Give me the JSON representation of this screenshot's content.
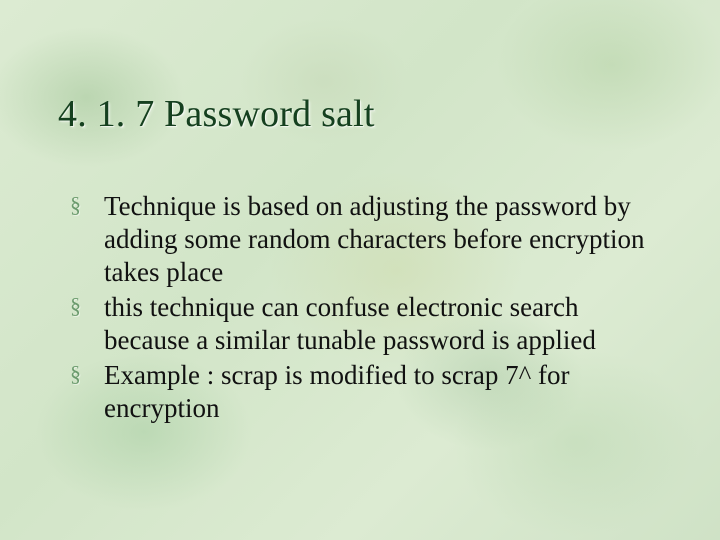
{
  "slide": {
    "title": "4. 1. 7 Password salt",
    "bullet_marker": "§",
    "bullets": [
      "Technique is based on adjusting the password by adding some random characters before encryption takes place",
      "this technique can confuse electronic  search because a similar tunable password is applied",
      "Example : scrap is modified to scrap 7^ for encryption"
    ]
  }
}
